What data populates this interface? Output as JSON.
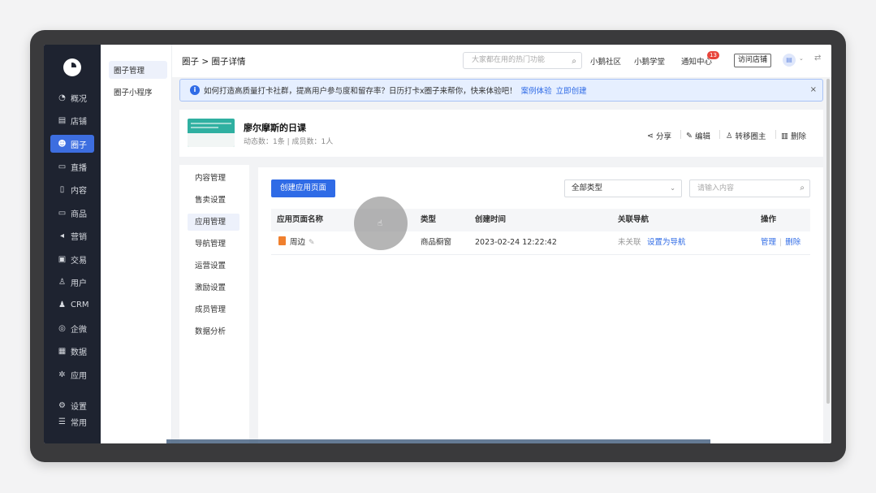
{
  "nav": {
    "items": [
      {
        "icon": "dashboard-icon",
        "glyph": "◔",
        "label": "概况"
      },
      {
        "icon": "store-icon",
        "glyph": "▤",
        "label": "店铺"
      },
      {
        "icon": "circle-group-icon",
        "glyph": "☻",
        "label": "圈子"
      },
      {
        "icon": "live-icon",
        "glyph": "▭",
        "label": "直播"
      },
      {
        "icon": "content-icon",
        "glyph": "▯",
        "label": "内容"
      },
      {
        "icon": "goods-icon",
        "glyph": "▭",
        "label": "商品"
      },
      {
        "icon": "marketing-icon",
        "glyph": "◂",
        "label": "营销"
      },
      {
        "icon": "trade-icon",
        "glyph": "▣",
        "label": "交易"
      },
      {
        "icon": "user-icon",
        "glyph": "♙",
        "label": "用户"
      },
      {
        "icon": "crm-icon",
        "glyph": "♟",
        "label": "CRM"
      },
      {
        "icon": "enterprise-wechat-icon",
        "glyph": "◎",
        "label": "企微"
      },
      {
        "icon": "data-icon",
        "glyph": "▦",
        "label": "数据"
      },
      {
        "icon": "apps-icon",
        "glyph": "✲",
        "label": "应用"
      },
      {
        "icon": "settings-icon",
        "glyph": "⚙",
        "label": "设置"
      },
      {
        "icon": "common-icon",
        "glyph": "☰",
        "label": "常用"
      }
    ]
  },
  "subnav": {
    "items": [
      "圈子管理",
      "圈子小程序"
    ]
  },
  "header": {
    "breadcrumb": "圈子 > 圈子详情",
    "search_placeholder": "大家都在用的热门功能",
    "links": [
      "小鹅社区",
      "小鹅学堂",
      "通知中心"
    ],
    "notify_count": "13",
    "visit_store": "访问店铺"
  },
  "notice": {
    "text": "如何打造高质量打卡社群，提高用户参与度和留存率？日历打卡x圈子来帮你，快来体验吧！",
    "link1": "案例体验",
    "link2": "立即创建"
  },
  "circle": {
    "title": "廖尔摩斯的日课",
    "stats": "动态数：1条 | 成员数：1人",
    "actions": [
      "分享",
      "编辑",
      "转移圈主",
      "删除"
    ]
  },
  "inner_nav": {
    "items": [
      "内容管理",
      "售卖设置",
      "应用管理",
      "导航管理",
      "运营设置",
      "激励设置",
      "成员管理",
      "数据分析"
    ]
  },
  "panel": {
    "create_button": "创建应用页面",
    "type_select": "全部类型",
    "search_placeholder": "请输入内容",
    "columns": [
      "应用页面名称",
      "类型",
      "创建时间",
      "关联导航",
      "操作"
    ],
    "rows": [
      {
        "name": "周边",
        "type": "商品橱窗",
        "created": "2023-02-24 12:22:42",
        "nav_status": "未关联",
        "nav_action": "设置为导航",
        "op1": "管理",
        "op2": "删除"
      }
    ]
  }
}
